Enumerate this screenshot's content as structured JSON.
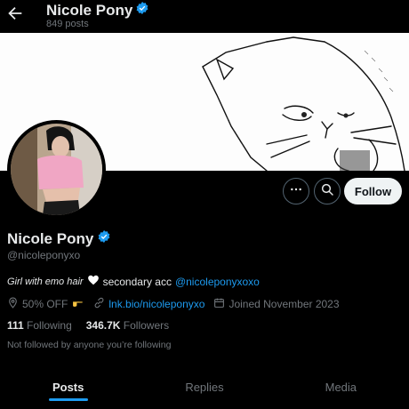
{
  "header": {
    "name": "Nicole Pony",
    "post_count": "849 posts"
  },
  "actions": {
    "follow_label": "Follow"
  },
  "profile": {
    "name": "Nicole Pony",
    "handle": "@nicoleponyxo",
    "bio": {
      "italic_text": "Girl with emo hair",
      "text": "secondary acc",
      "mention": "@nicoleponyxoxo"
    },
    "location": "50% OFF",
    "link": "lnk.bio/nicoleponyxo",
    "joined": "Joined November 2023",
    "following_count": "111",
    "following_label": "Following",
    "followers_count": "346.7K",
    "followers_label": "Followers",
    "followed_note": "Not followed by anyone you’re following"
  },
  "tabs": [
    {
      "label": "Posts",
      "active": true
    },
    {
      "label": "Replies",
      "active": false
    },
    {
      "label": "Media",
      "active": false
    }
  ],
  "colors": {
    "accent": "#1d9bf0",
    "background": "#000000",
    "muted": "#71767b",
    "text": "#e7e9ea"
  }
}
